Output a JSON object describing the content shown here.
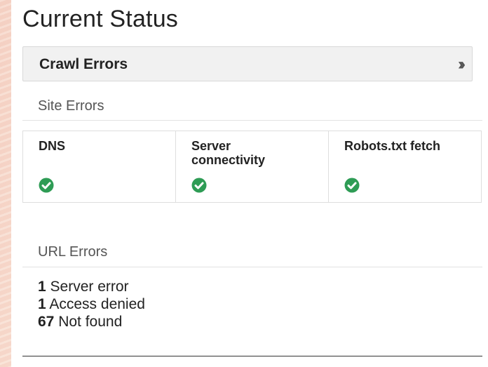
{
  "page": {
    "title": "Current Status"
  },
  "crawl_errors": {
    "label": "Crawl Errors",
    "expand_icon": "double-chevron-right-icon",
    "expand_glyph": "»"
  },
  "site_errors": {
    "heading": "Site Errors",
    "items": [
      {
        "label": "DNS",
        "status_icon": "check-circle-icon",
        "status_color": "#2e9c55"
      },
      {
        "label": "Server connectivity",
        "status_icon": "check-circle-icon",
        "status_color": "#2e9c55"
      },
      {
        "label": "Robots.txt fetch",
        "status_icon": "check-circle-icon",
        "status_color": "#2e9c55"
      }
    ]
  },
  "url_errors": {
    "heading": "URL Errors",
    "items": [
      {
        "count": "1",
        "label": "Server error"
      },
      {
        "count": "1",
        "label": "Access denied"
      },
      {
        "count": "67",
        "label": "Not found"
      }
    ]
  }
}
